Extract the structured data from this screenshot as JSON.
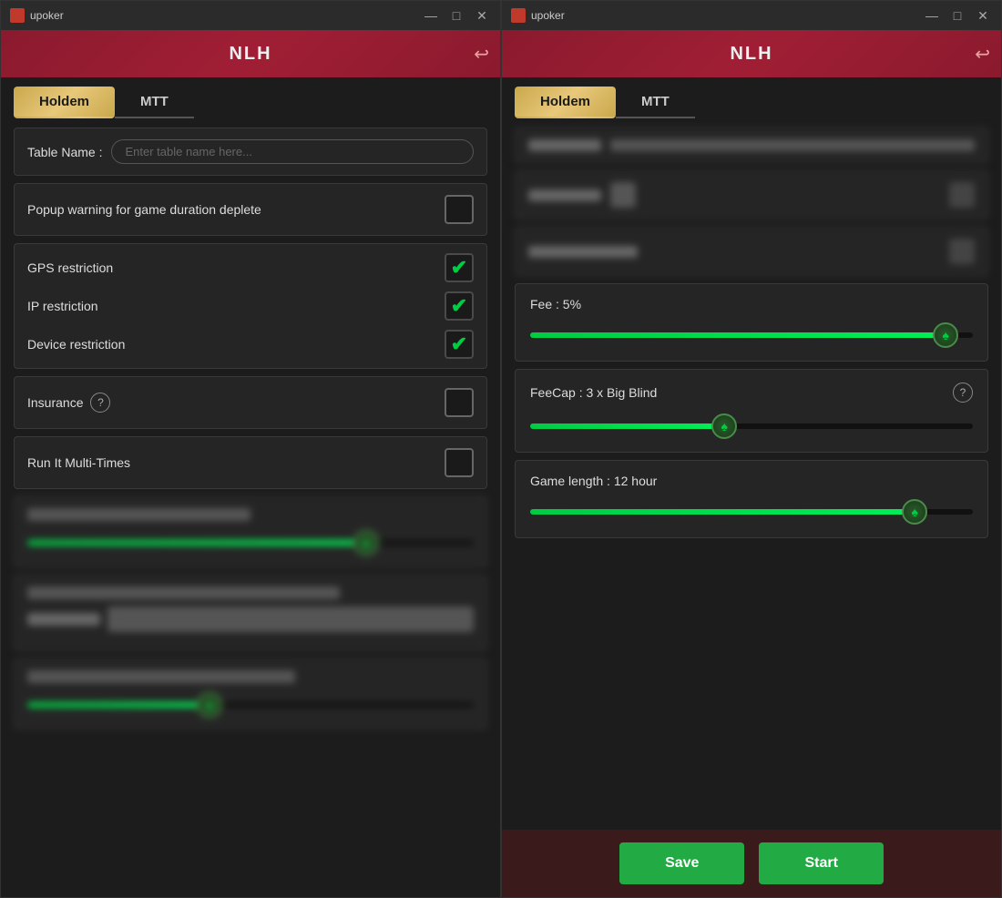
{
  "left_window": {
    "titlebar": {
      "app_name": "upoker",
      "min_btn": "—",
      "max_btn": "□",
      "close_btn": "✕"
    },
    "header": {
      "title": "NLH",
      "back_icon": "↩"
    },
    "tabs": [
      {
        "id": "holdem",
        "label": "Holdem",
        "active": true
      },
      {
        "id": "mtt",
        "label": "MTT",
        "active": false
      }
    ],
    "fields": {
      "table_name_label": "Table Name :",
      "table_name_placeholder": "Enter table name here...",
      "popup_warning_label": "Popup warning for game duration deplete",
      "gps_restriction_label": "GPS restriction",
      "ip_restriction_label": "IP restriction",
      "device_restriction_label": "Device restriction",
      "insurance_label": "Insurance",
      "run_it_label": "Run It Multi-Times"
    },
    "blurred_sections": {
      "section1_title": "Fee : 5%",
      "section2_title": "FeeCap : 3 x Big Blind",
      "section3_title": "Game length : 14 hour"
    }
  },
  "right_window": {
    "titlebar": {
      "app_name": "upoker",
      "min_btn": "—",
      "max_btn": "□",
      "close_btn": "✕"
    },
    "header": {
      "title": "NLH",
      "back_icon": "↩"
    },
    "tabs": [
      {
        "id": "holdem",
        "label": "Holdem",
        "active": true
      },
      {
        "id": "mtt",
        "label": "MTT",
        "active": false
      }
    ],
    "sliders": {
      "fee_label": "Fee : 5%",
      "fee_fill_percent": 95,
      "feecap_label": "FeeCap : 3 x Big Blind",
      "feecap_fill_percent": 45,
      "game_length_label": "Game length : 12 hour",
      "game_length_fill_percent": 88
    },
    "footer": {
      "save_label": "Save",
      "start_label": "Start"
    }
  },
  "icons": {
    "spade": "♠",
    "check": "✔",
    "question": "?",
    "back_arrow": "↩"
  }
}
